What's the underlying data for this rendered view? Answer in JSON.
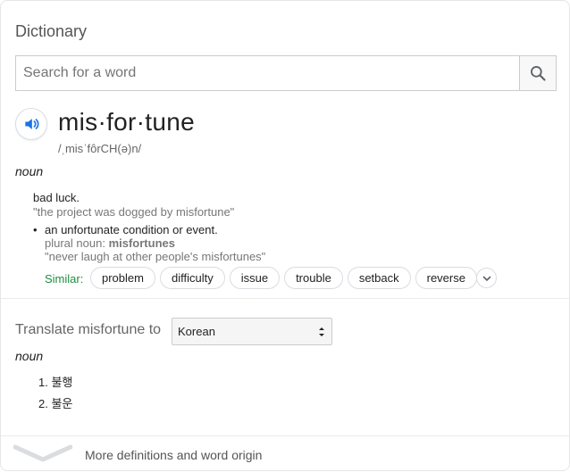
{
  "header": {
    "title": "Dictionary"
  },
  "search": {
    "placeholder": "Search for a word",
    "value": ""
  },
  "entry": {
    "word": "mis·for·tune",
    "phonetic": "/ˌmisˈfôrCH(ə)n/",
    "part_of_speech": "noun",
    "definitions": [
      {
        "text": "bad luck.",
        "example": "\"the project was dogged by misfortune\""
      },
      {
        "text": "an unfortunate condition or event.",
        "plural_label": "plural noun:",
        "plural": "misfortunes",
        "example": "\"never laugh at other people's misfortunes\""
      }
    ],
    "similar_label": "Similar:",
    "similar": [
      "problem",
      "difficulty",
      "issue",
      "trouble",
      "setback",
      "reverse"
    ]
  },
  "translate": {
    "label": "Translate misfortune to",
    "language": "Korean",
    "part_of_speech": "noun",
    "items": [
      "1. 불행",
      "2. 불운"
    ]
  },
  "footer": {
    "more_label": "More definitions and word origin"
  },
  "colors": {
    "accent": "#1a73e8",
    "similar": "#1e8e3e"
  }
}
